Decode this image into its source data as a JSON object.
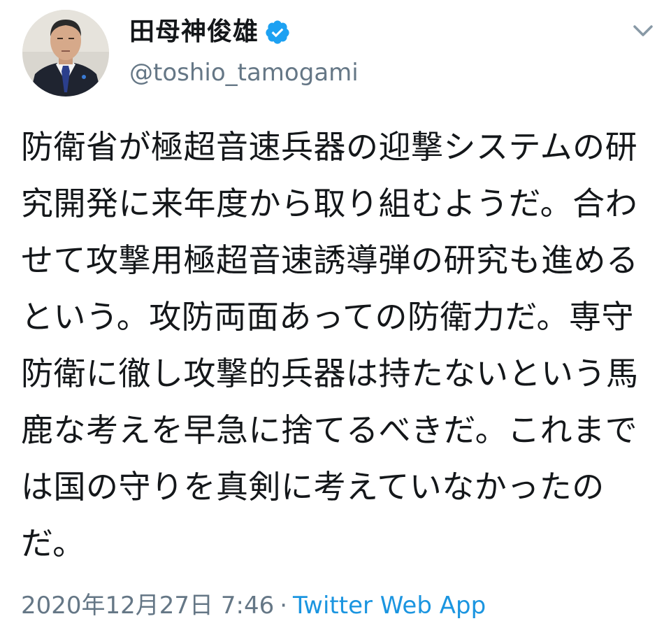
{
  "tweet": {
    "author": {
      "display_name": "田母神俊雄",
      "handle": "@toshio_tamogami",
      "verified_icon": "verified-badge-icon",
      "avatar_icon": "avatar"
    },
    "menu_icon": "chevron-down-icon",
    "text": "防衛省が極超音速兵器の迎撃システムの研究開発に来年度から取り組むようだ。合わせて攻撃用極超音速誘導弾の研究も進めるという。攻防両面あっての防衛力だ。専守防衛に徹し攻撃的兵器は持たないという馬鹿な考えを早急に捨てるべきだ。これまでは国の守りを真剣に考えていなかったのだ。",
    "timestamp": "2020年12月27日 7:46",
    "separator": "·",
    "source": "Twitter Web App"
  },
  "colors": {
    "text": "#14171a",
    "secondary": "#657786",
    "link": "#1b95e0",
    "verified": "#1da1f2"
  }
}
